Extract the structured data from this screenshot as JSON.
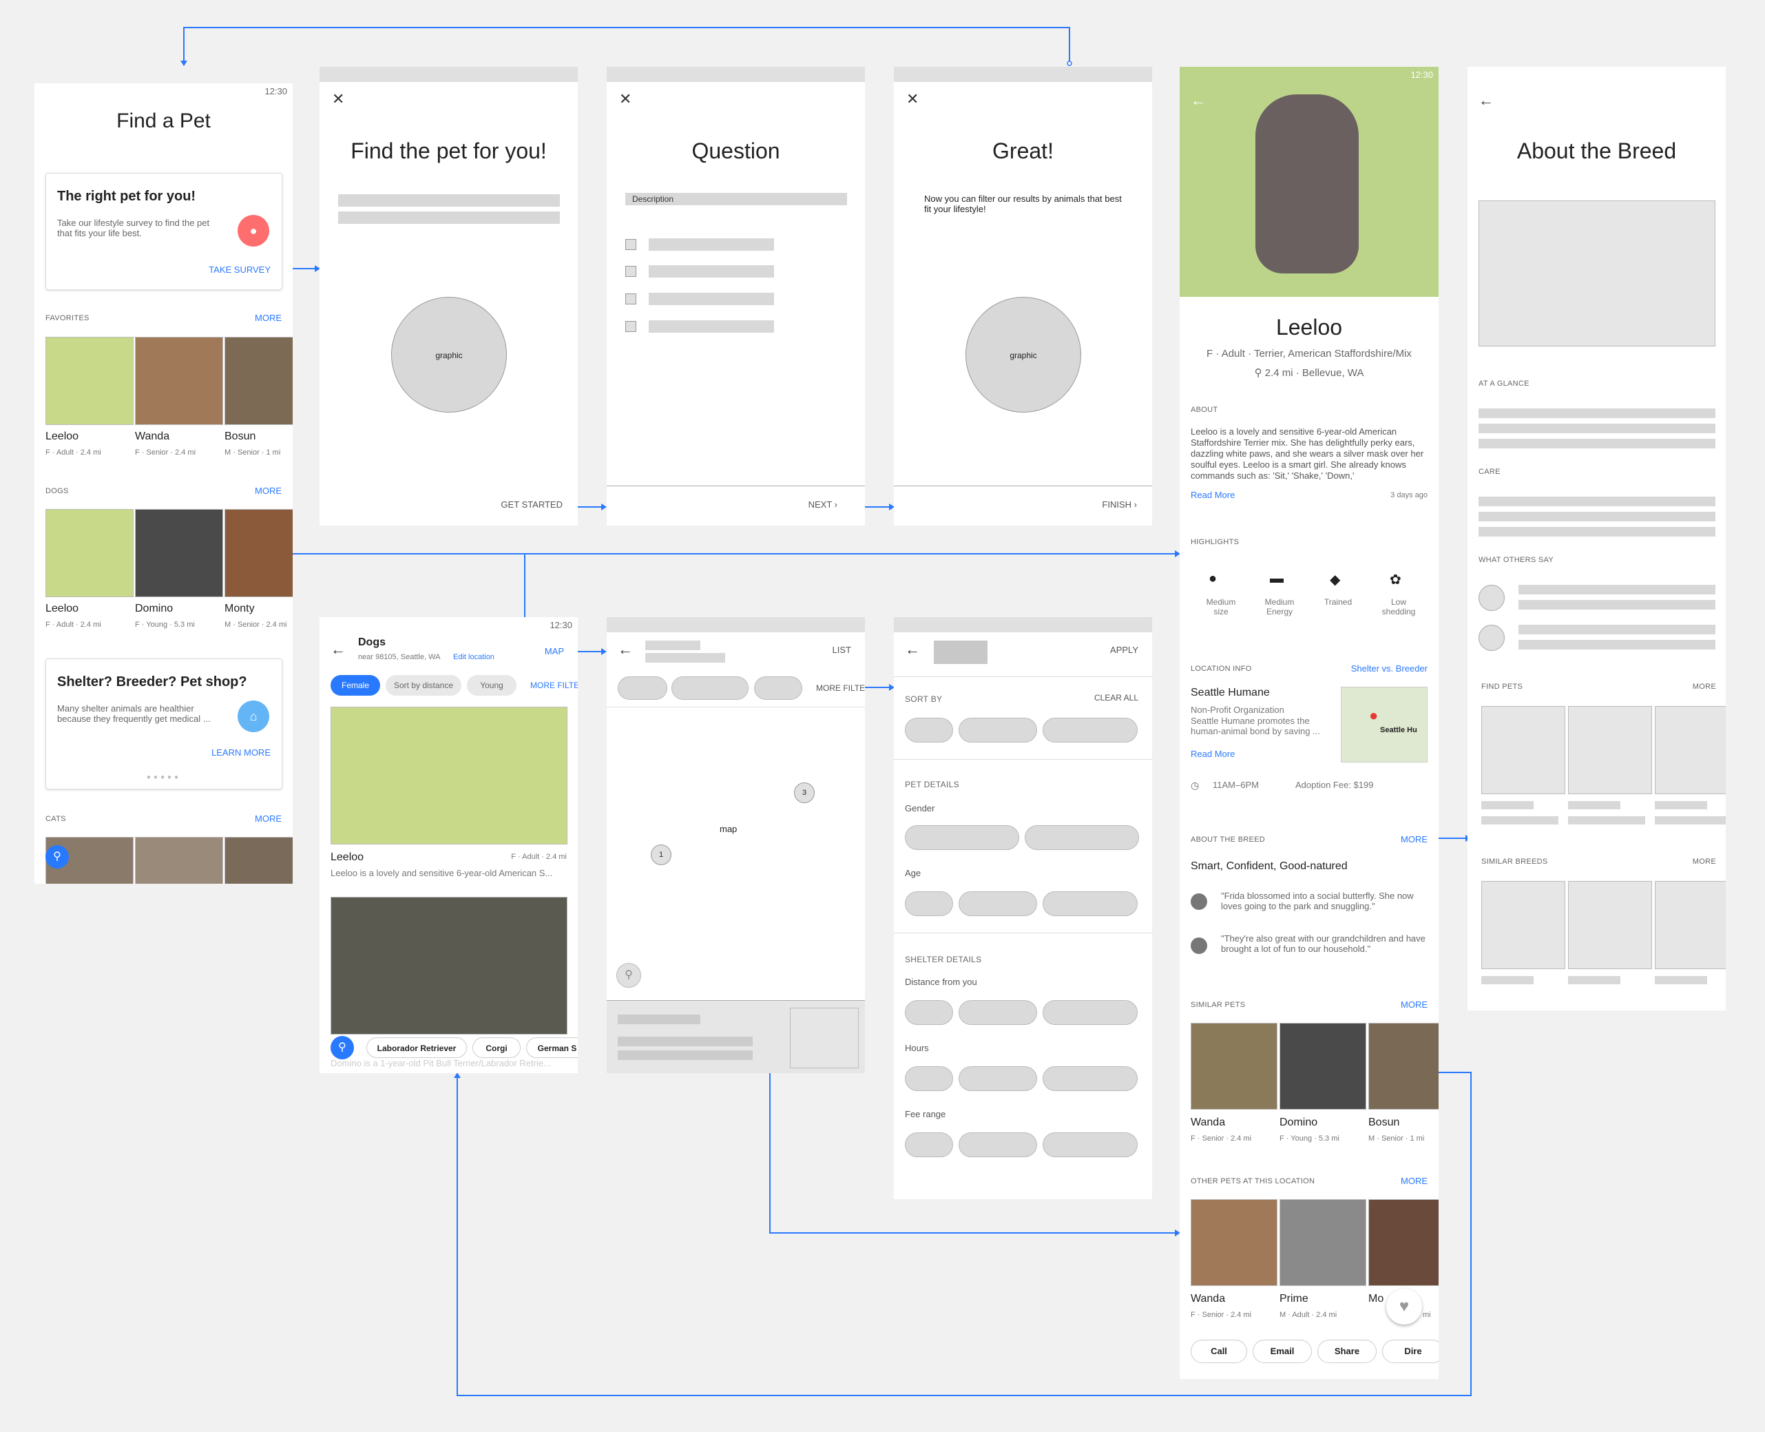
{
  "status_time": "12:30",
  "s1": {
    "title": "Find a Pet",
    "survey_title": "The right pet for you!",
    "survey_desc": "Take our lifestyle survey to find the pet that fits your life best.",
    "survey_btn": "TAKE SURVEY",
    "favorites": "FAVORITES",
    "more": "MORE",
    "dogs": "DOGS",
    "cats": "CATS",
    "fav": [
      {
        "name": "Leeloo",
        "meta": "F · Adult · 2.4 mi"
      },
      {
        "name": "Wanda",
        "meta": "F · Senior · 2.4 mi"
      },
      {
        "name": "Bosun",
        "meta": "M · Senior · 1 mi"
      }
    ],
    "dogs_list": [
      {
        "name": "Leeloo",
        "meta": "F · Adult · 2.4 mi"
      },
      {
        "name": "Domino",
        "meta": "F · Young · 5.3 mi"
      },
      {
        "name": "Monty",
        "meta": "M · Senior · 2.4 mi"
      }
    ],
    "shelter_title": "Shelter? Breeder? Pet shop?",
    "shelter_desc": "Many shelter animals are healthier because they frequently get medical ...",
    "learn_more": "LEARN MORE"
  },
  "s2": {
    "title": "Find the pet for you!",
    "graphic": "graphic",
    "action": "GET STARTED"
  },
  "s3": {
    "title": "Question",
    "desc": "Description",
    "action": "NEXT"
  },
  "s4": {
    "title": "Great!",
    "text": "Now you can filter our results by animals that best fit your lifestyle!",
    "graphic": "graphic",
    "action": "FINISH"
  },
  "s5": {
    "name": "Leeloo",
    "meta": "F · Adult · Terrier, American Staffordshire/Mix",
    "location": "2.4 mi · Bellevue, WA",
    "about": "ABOUT",
    "about_text": "Leeloo is a lovely and sensitive 6-year-old American Staffordshire Terrier mix. She has delightfully perky ears, dazzling white paws, and she wears a silver mask over her soulful eyes. Leeloo is a smart girl. She already knows commands such as: 'Sit,' 'Shake,' 'Down,'",
    "read_more": "Read More",
    "updated": "3 days ago",
    "highlights": "HIGHLIGHTS",
    "hl": [
      {
        "icon": "paw-icon",
        "label": "Medium size"
      },
      {
        "icon": "sofa-icon",
        "label": "Medium Energy"
      },
      {
        "icon": "cap-icon",
        "label": "Trained"
      },
      {
        "icon": "shedding-icon",
        "label": "Low shedding"
      }
    ],
    "location_info": "LOCATION INFO",
    "shelter_vs": "Shelter vs. Breeder",
    "shelter_name": "Seattle Humane",
    "shelter_type": "Non-Profit Organization",
    "shelter_desc": "Seattle Humane promotes the human-animal bond by saving ...",
    "map_label": "Seattle Hu",
    "hours": "11AM–6PM",
    "fee": "Adoption Fee: $199",
    "about_breed": "ABOUT THE BREED",
    "more": "MORE",
    "breed_traits": "Smart, Confident, Good-natured",
    "quotes": [
      "\"Frida blossomed into a social butterfly. She now loves going to the park and snuggling.\"",
      "\"They're also great with our grandchildren and have brought a lot of fun to our household.\""
    ],
    "similar": "SIMILAR PETS",
    "similar_list": [
      {
        "name": "Wanda",
        "meta": "F · Senior · 2.4 mi"
      },
      {
        "name": "Domino",
        "meta": "F · Young · 5.3 mi"
      },
      {
        "name": "Bosun",
        "meta": "M · Senior · 1 mi"
      }
    ],
    "other": "OTHER PETS AT THIS LOCATION",
    "other_list": [
      {
        "name": "Wanda",
        "meta": "F · Senior · 2.4 mi"
      },
      {
        "name": "Prime",
        "meta": "M · Adult · 2.4 mi"
      },
      {
        "name": "Mo",
        "meta": "mi"
      }
    ],
    "actions": [
      "Call",
      "Email",
      "Share",
      "Dire"
    ]
  },
  "s6": {
    "title": "About the Breed",
    "glance": "AT A GLANCE",
    "care": "CARE",
    "others": "WHAT OTHERS SAY",
    "find": "FIND PETS",
    "more": "MORE",
    "similar": "SIMILAR BREEDS"
  },
  "s7": {
    "title": "Dogs",
    "sub": "near 98105, Seattle, WA",
    "edit": "Edit location",
    "map": "MAP",
    "filters": [
      "Female",
      "Sort by distance",
      "Young",
      "MORE FILTERS"
    ],
    "pet1": {
      "name": "Leeloo",
      "meta": "F · Adult · 2.4 mi",
      "desc": "Leeloo is a lovely and sensitive 6-year-old American S..."
    },
    "pet2": {
      "desc": "Domino is a 1-year-old Pit Bull Terrier/Labrador Retrie..."
    },
    "breeds": [
      "Laborador Retriever",
      "Corgi",
      "German S"
    ]
  },
  "s8": {
    "list": "LIST",
    "more": "MORE FILTERS",
    "map": "map",
    "m1": "3",
    "m2": "1"
  },
  "s9": {
    "apply": "APPLY",
    "sort_by": "SORT BY",
    "clear": "CLEAR ALL",
    "pet_details": "PET DETAILS",
    "gender": "Gender",
    "age": "Age",
    "shelter_details": "SHELTER DETAILS",
    "distance": "Distance from you",
    "hours": "Hours",
    "fee": "Fee range"
  },
  "colors": {
    "accent": "#2979ff",
    "survey_circle": "#ff6e6e",
    "shelter_circle": "#64b5f6"
  }
}
